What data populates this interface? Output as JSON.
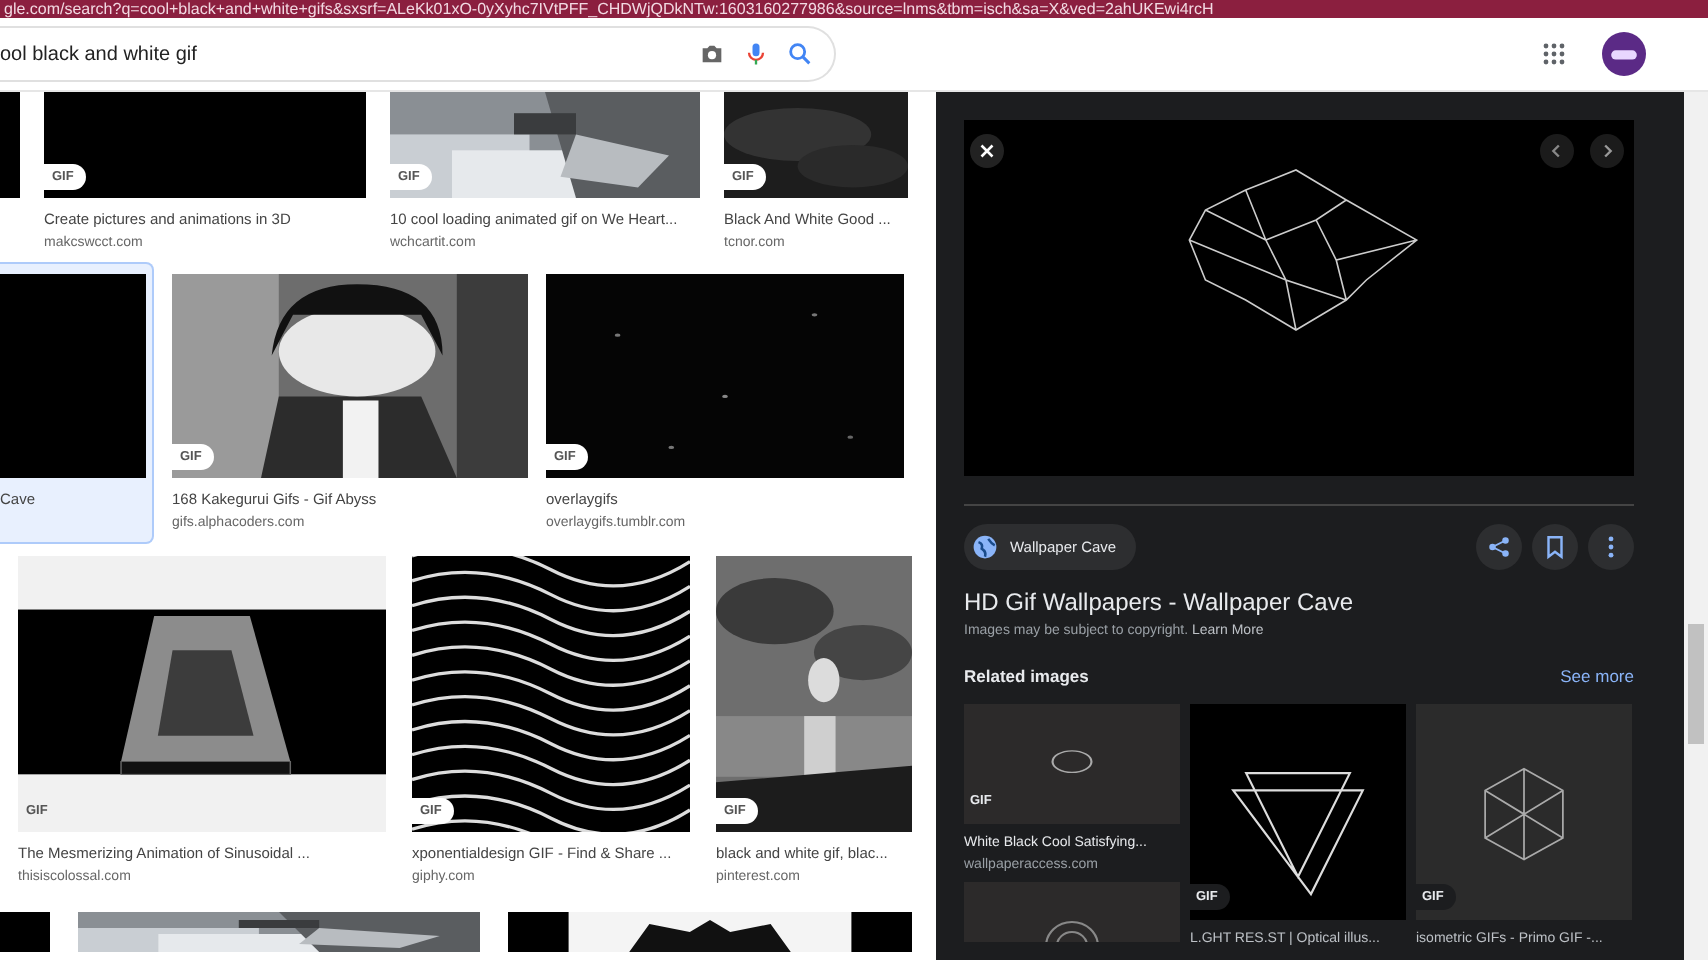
{
  "address_bar": {
    "url": "gle.com/search?q=cool+black+and+white+gifs&sxsrf=ALeKk01xO-0yXyhc7IVtPFF_CHDWjQDkNTw:1603160277986&source=lnms&tbm=isch&sa=X&ved=2ahUKEwi4rcH"
  },
  "search": {
    "value": "ool black and white gif"
  },
  "results": [
    [
      {
        "kind": "picture"
      },
      {
        "kind": "result",
        "badge": "GIF",
        "title": "Create pictures and animations in 3D",
        "source": "makcswcct.com"
      },
      {
        "kind": "result",
        "badge": "GIF",
        "title": "10 cool loading animated gif on We Heart...",
        "source": "wchcartit.com"
      },
      {
        "kind": "result",
        "badge": "GIF",
        "title": "Black And White Good ...",
        "source": "tcnor.com"
      }
    ],
    [
      {
        "kind": "result",
        "selected": true,
        "title": "Cave"
      },
      {
        "kind": "result",
        "selected": false,
        "badge": "GIF",
        "title": "168 Kakegurui Gifs - Gif Abyss",
        "source": "gifs.alphacoders.com"
      },
      {
        "kind": "result",
        "selected": false,
        "badge": "GIF",
        "title": "overlaygifs",
        "source": "overlaygifs.tumblr.com"
      }
    ],
    [
      {
        "kind": "result",
        "badge": "GIF",
        "title": "The Mesmerizing Animation of Sinusoidal ...",
        "source": "thisiscolossal.com"
      },
      {
        "kind": "result",
        "badge": "GIF",
        "title": "xponentialdesign GIF - Find & Share ...",
        "source": "giphy.com"
      },
      {
        "kind": "result",
        "badge": "GIF",
        "title": "black and white gif, blac...",
        "source": "pinterest.com"
      }
    ],
    [
      {
        "kind": "picture"
      },
      {
        "kind": "picture"
      },
      {
        "kind": "picture"
      }
    ]
  ],
  "preview": {
    "source": "Wallpaper Cave",
    "title": "HD Gif Wallpapers - Wallpaper Cave",
    "notice": "Images may be subject to copyright.",
    "notice_link": "Learn More",
    "related_heading": "Related images",
    "see_more": "See more",
    "related": [
      {
        "badge": "GIF",
        "title": "White Black Cool Satisfying...",
        "source": "wallpaperaccess.com"
      },
      {
        "badge": "GIF",
        "title": "L.GHT RES.ST | Optical illus..."
      },
      {
        "badge": "GIF",
        "title": "isometric GIFs - Primo GIF -..."
      }
    ]
  }
}
